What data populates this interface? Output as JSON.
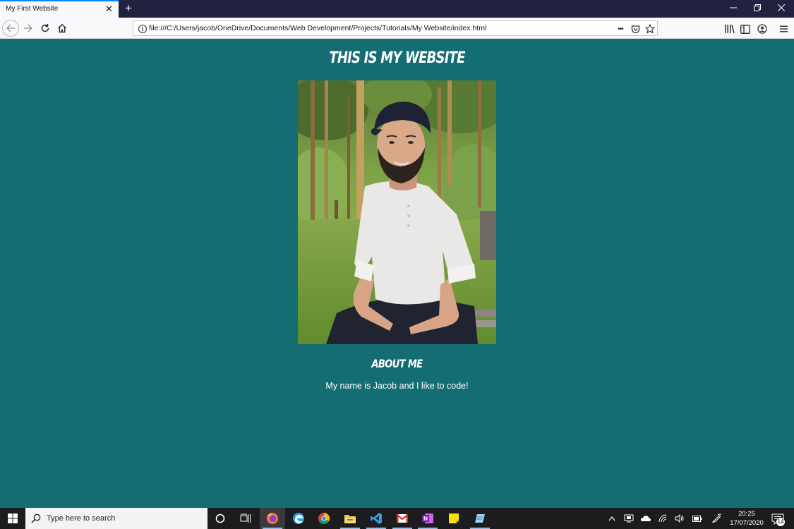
{
  "browser": {
    "tab_title": "My First Website",
    "tab_close": "✕",
    "new_tab": "+",
    "url": "file:///C:/Users/jacob/OneDrive/Documents/Web Development/Projects/Tutorials/My Website/index.html",
    "url_more": "•••",
    "window_controls": {
      "minimize": "—",
      "restore": "❐",
      "close": "✕"
    }
  },
  "page": {
    "title": "This is my Website",
    "about_heading": "About Me",
    "about_text": "My name is Jacob and I like to code!",
    "background_color": "#146d72",
    "photo_icon": "portrait-photo"
  },
  "taskbar": {
    "search_placeholder": "Type here to search",
    "time": "20:25",
    "date": "17/07/2020",
    "notification_count": "14",
    "apps": [
      "cortana-icon",
      "task-view-icon",
      "firefox-icon",
      "edge-icon",
      "chrome-icon",
      "file-explorer-icon",
      "vscode-icon",
      "gmail-icon",
      "onenote-icon",
      "sticky-notes-icon",
      "notepad-icon"
    ]
  }
}
